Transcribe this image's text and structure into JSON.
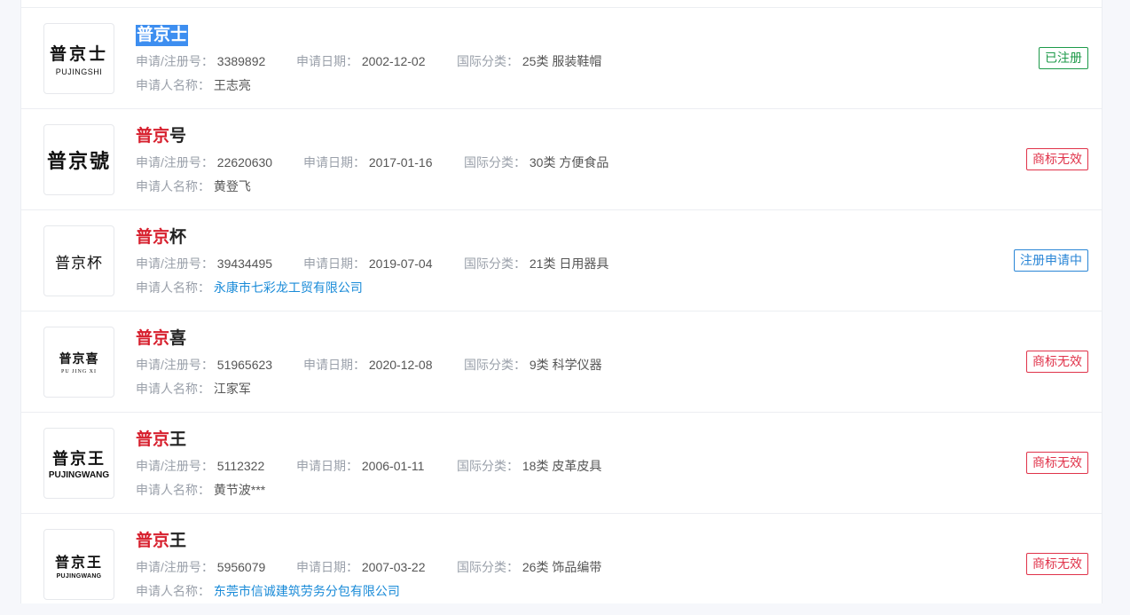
{
  "labels": {
    "reg_no": "申请/注册号：",
    "date": "申请日期：",
    "class": "国际分类：",
    "applicant": "申请人名称："
  },
  "records": [
    {
      "logo_cn": "普京士",
      "logo_en": "PUJINGSHI",
      "title_hl": "普京",
      "title_rest": "士",
      "reg_no": "3389892",
      "date": "2002-12-02",
      "class": "25类 服装鞋帽",
      "applicant": "王志亮",
      "status": "已注册"
    },
    {
      "logo_cn": "普京號",
      "logo_en": "",
      "title_hl": "普京",
      "title_rest": "号",
      "reg_no": "22620630",
      "date": "2017-01-16",
      "class": "30类 方便食品",
      "applicant": "黄登飞",
      "status": "商标无效"
    },
    {
      "logo_cn": "普京杯",
      "logo_en": "",
      "title_hl": "普京",
      "title_rest": "杯",
      "reg_no": "39434495",
      "date": "2019-07-04",
      "class": "21类 日用器具",
      "applicant": "永康市七彩龙工贸有限公司",
      "status": "注册申请中"
    },
    {
      "logo_cn": "普京喜",
      "logo_en": "PU JING XI",
      "title_hl": "普京",
      "title_rest": "喜",
      "reg_no": "51965623",
      "date": "2020-12-08",
      "class": "9类 科学仪器",
      "applicant": "江家军",
      "status": "商标无效"
    },
    {
      "logo_cn": "普京王",
      "logo_en": "PUJINGWANG",
      "title_hl": "普京",
      "title_rest": "王",
      "reg_no": "5112322",
      "date": "2006-01-11",
      "class": "18类 皮革皮具",
      "applicant": "黄节波***",
      "status": "商标无效"
    },
    {
      "logo_cn": "普京王",
      "logo_en": "PUJINGWANG",
      "title_hl": "普京",
      "title_rest": "王",
      "reg_no": "5956079",
      "date": "2007-03-22",
      "class": "26类 饰品编带",
      "applicant": "东莞市信诚建筑劳务分包有限公司",
      "status": "商标无效"
    }
  ],
  "colors": {
    "highlight": "#d7202e",
    "selection": "#3d8ef0",
    "status_registered": "#1d9a49",
    "status_invalid": "#e0334a",
    "status_pending": "#2a86d6",
    "link": "#1a8bd8"
  }
}
